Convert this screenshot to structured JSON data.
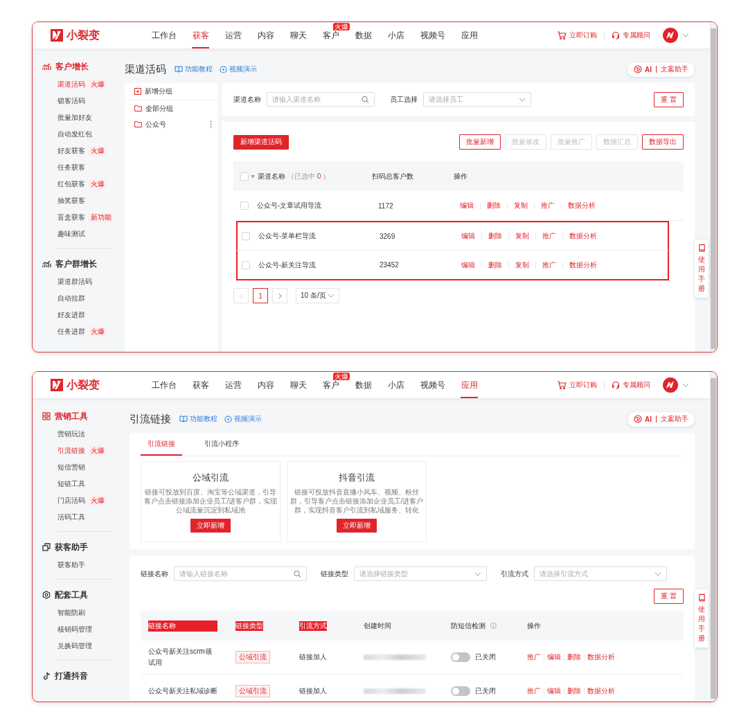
{
  "screens": [
    {
      "kind": "channel_codes",
      "header": {
        "logo": "小裂变",
        "nav": [
          {
            "label": "工作台",
            "selected": false
          },
          {
            "label": "获客",
            "selected": true
          },
          {
            "label": "运营",
            "selected": false
          },
          {
            "label": "内容",
            "selected": false
          },
          {
            "label": "聊天",
            "selected": false
          },
          {
            "label": "客户",
            "selected": false,
            "badge": "火爆"
          },
          {
            "label": "数据",
            "selected": false
          },
          {
            "label": "小店",
            "selected": false
          },
          {
            "label": "视频号",
            "selected": false
          },
          {
            "label": "应用",
            "selected": false
          }
        ],
        "actions": [
          {
            "kind": "cart",
            "label": "立即订购"
          },
          {
            "kind": "headset",
            "label": "专属顾问"
          }
        ]
      },
      "sidebar": [
        {
          "title": "客户增长",
          "selected": true,
          "items": [
            {
              "label": "渠道活码",
              "selected": true,
              "tag": "火爆"
            },
            {
              "label": "锁客活码",
              "selected": false
            },
            {
              "label": "批量加好友",
              "selected": false
            },
            {
              "label": "自动发红包",
              "selected": false
            },
            {
              "label": "好友获客",
              "selected": false,
              "tag": "火爆"
            },
            {
              "label": "任务获客",
              "selected": false
            },
            {
              "label": "红包获客",
              "selected": false,
              "tag": "火爆"
            },
            {
              "label": "抽奖获客",
              "selected": false
            },
            {
              "label": "盲盒获客",
              "selected": false,
              "tag": "新功能"
            },
            {
              "label": "趣味测试",
              "selected": false
            }
          ]
        },
        {
          "title": "客户群增长",
          "selected": false,
          "items": [
            {
              "label": "渠道群活码",
              "selected": false
            },
            {
              "label": "自动拉群",
              "selected": false
            },
            {
              "label": "好友进群",
              "selected": false
            },
            {
              "label": "任务进群",
              "selected": false,
              "tag": "火爆"
            }
          ]
        }
      ],
      "page": {
        "title": "渠道活码",
        "links": [
          {
            "kind": "book",
            "label": "功能教程"
          },
          {
            "kind": "play",
            "label": "视频演示"
          }
        ],
        "assistant": {
          "label": "AI",
          "text": "文案助手"
        }
      },
      "groups": {
        "add": "新增分组",
        "items": [
          {
            "label": "全部分组",
            "menu": false
          },
          {
            "label": "公众号",
            "menu": true
          }
        ]
      },
      "filters": [
        {
          "label": "渠道名称",
          "kind": "search",
          "placeholder": "请输入渠道名称"
        },
        {
          "label": "员工选择",
          "kind": "select",
          "placeholder": "请选择员工"
        }
      ],
      "reset": "重 置",
      "create": "新增渠道活码",
      "toolbar": [
        {
          "label": "批量新增",
          "disabled": false
        },
        {
          "label": "批量修改",
          "disabled": true
        },
        {
          "label": "批量推广",
          "disabled": true
        },
        {
          "label": "数据汇总",
          "disabled": true
        },
        {
          "label": "数据导出",
          "disabled": false
        }
      ],
      "table": {
        "checked": false,
        "columns": [
          "渠道名称",
          "扫码总客户数",
          "操作"
        ],
        "selection": {
          "prefix": "（已选中",
          "count": "0",
          "suffix": "）"
        },
        "rows": [
          {
            "name": "公众号-文章试用导流",
            "count": "1172",
            "checked": false,
            "highlighted": false,
            "actions": [
              "编辑",
              "删除",
              "复制",
              "推广",
              "数据分析"
            ]
          },
          {
            "name": "公众号-菜单栏导流",
            "count": "3269",
            "checked": false,
            "highlighted": true,
            "actions": [
              "编辑",
              "删除",
              "复制",
              "推广",
              "数据分析"
            ]
          },
          {
            "name": "公众号-新关注导流",
            "count": "23452",
            "checked": false,
            "highlighted": true,
            "actions": [
              "编辑",
              "删除",
              "复制",
              "推广",
              "数据分析"
            ]
          }
        ]
      },
      "pagination": {
        "page": "1",
        "page_size": "10 条/页"
      },
      "manual": "使用手册"
    },
    {
      "kind": "traffic_links",
      "header": {
        "logo": "小裂变",
        "nav": [
          {
            "label": "工作台",
            "selected": false
          },
          {
            "label": "获客",
            "selected": false
          },
          {
            "label": "运营",
            "selected": false
          },
          {
            "label": "内容",
            "selected": false
          },
          {
            "label": "聊天",
            "selected": false
          },
          {
            "label": "客户",
            "selected": false,
            "badge": "火爆"
          },
          {
            "label": "数据",
            "selected": false
          },
          {
            "label": "小店",
            "selected": false
          },
          {
            "label": "视频号",
            "selected": false
          },
          {
            "label": "应用",
            "selected": true
          }
        ],
        "actions": [
          {
            "kind": "cart",
            "label": "立即订购"
          },
          {
            "kind": "headset",
            "label": "专属顾问"
          }
        ]
      },
      "sidebar": [
        {
          "title": "营销工具",
          "selected": true,
          "items": [
            {
              "label": "营销玩法",
              "selected": false
            },
            {
              "label": "引流链接",
              "selected": true,
              "tag": "火爆"
            },
            {
              "label": "短信营销",
              "selected": false
            },
            {
              "label": "短链工具",
              "selected": false
            },
            {
              "label": "门店活码",
              "selected": false,
              "tag": "火爆"
            },
            {
              "label": "活码工具",
              "selected": false
            }
          ]
        },
        {
          "title": "获客助手",
          "selected": false,
          "items": [
            {
              "label": "获客助手",
              "selected": false
            }
          ]
        },
        {
          "title": "配套工具",
          "selected": false,
          "items": [
            {
              "label": "智能防刷",
              "selected": false
            },
            {
              "label": "核销码管理",
              "selected": false
            },
            {
              "label": "兑换码管理",
              "selected": false
            }
          ]
        },
        {
          "title": "打通抖音",
          "selected": false
        }
      ],
      "page": {
        "title": "引流链接",
        "links": [
          {
            "kind": "book",
            "label": "功能教程"
          },
          {
            "kind": "play",
            "label": "视频演示"
          }
        ],
        "assistant": {
          "label": "AI",
          "text": "文案助手"
        }
      },
      "tabs": [
        {
          "label": "引流链接",
          "selected": true
        },
        {
          "label": "引流小程序",
          "selected": false
        }
      ],
      "cards": [
        {
          "title": "公域引流",
          "text": "链接可投放到百度、淘宝等公域渠道，引导客户点击链接添加企业员工/进客户群，实现公域流量沉淀到私域池",
          "button": "立即新增"
        },
        {
          "title": "抖音引流",
          "text": "链接可投放抖音直播小风车、视频、粉丝群，引导客户点击链接添加企业员工/进客户群，实现抖音客户引流到私域服务、转化",
          "button": "立即新增"
        }
      ],
      "filters": [
        {
          "label": "链接名称",
          "kind": "search",
          "placeholder": "请输入链接名称"
        },
        {
          "label": "链接类型",
          "kind": "select",
          "placeholder": "请选择链接类型"
        },
        {
          "label": "引流方式",
          "kind": "select",
          "placeholder": "请选择引流方式"
        }
      ],
      "reset": "重 置",
      "table": {
        "columns": [
          {
            "label": "链接名称",
            "highlighted": true,
            "info": false
          },
          {
            "label": "链接类型",
            "highlighted": true,
            "info": false
          },
          {
            "label": "引流方式",
            "highlighted": true,
            "info": false
          },
          {
            "label": "创建时间",
            "highlighted": false,
            "info": false
          },
          {
            "label": "防短信检测",
            "highlighted": false,
            "info": true
          },
          {
            "label": "操作",
            "highlighted": false,
            "info": false
          }
        ],
        "rows": [
          {
            "name": "公众号新关注scrm领试用",
            "type": "公域引流",
            "method": "链接加人",
            "on": false,
            "status": "已关闭",
            "actions": [
              "推广",
              "编辑",
              "删除",
              "数据分析"
            ]
          },
          {
            "name": "公众号新关注私域诊断",
            "type": "公域引流",
            "method": "链接加人",
            "on": false,
            "status": "已关闭",
            "actions": [
              "推广",
              "编辑",
              "删除",
              "数据分析"
            ]
          }
        ]
      },
      "manual": "使用手册"
    }
  ]
}
